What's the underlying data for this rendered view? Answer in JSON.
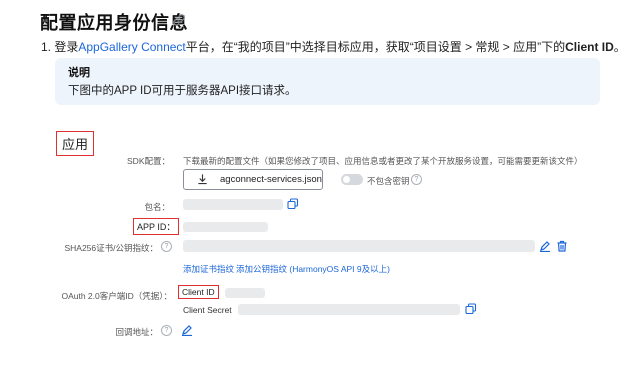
{
  "heading": {
    "title": "配置应用身份信息"
  },
  "step": {
    "number": "1.",
    "text_before": "登录",
    "link": "AppGallery Connect",
    "text_middle": "平台，在“我的项目”中选择目标应用，获取“项目设置 > 常规 > 应用”下的",
    "bold": "Client ID",
    "text_end": "。"
  },
  "note": {
    "title": "说明",
    "body": "下图中的APP ID可用于服务器API接口请求。"
  },
  "app_section": {
    "title": "应用",
    "sdk_label": "SDK配置：",
    "sdk_desc": "下载最新的配置文件（如果您修改了项目、应用信息或者更改了某个开放服务设置，可能需要更新该文件）",
    "download_button": "agconnect-services.json",
    "toggle_label": "不包含密钥",
    "package_label": "包名：",
    "app_id_label": "APP ID：",
    "sha_label": "SHA256证书/公钥指纹：",
    "add_cert_link": "添加证书指纹",
    "add_pubkey_link": "添加公钥指纹 (HarmonyOS API 9及以上)",
    "oauth_label": "OAuth 2.0客户端ID（凭据）：",
    "client_id_label": "Client ID",
    "client_secret_label": "Client Secret",
    "callback_label": "回调地址："
  },
  "colors": {
    "accent": "#1c67d8",
    "highlight": "#e03131",
    "note_bg": "#eef4fc"
  }
}
